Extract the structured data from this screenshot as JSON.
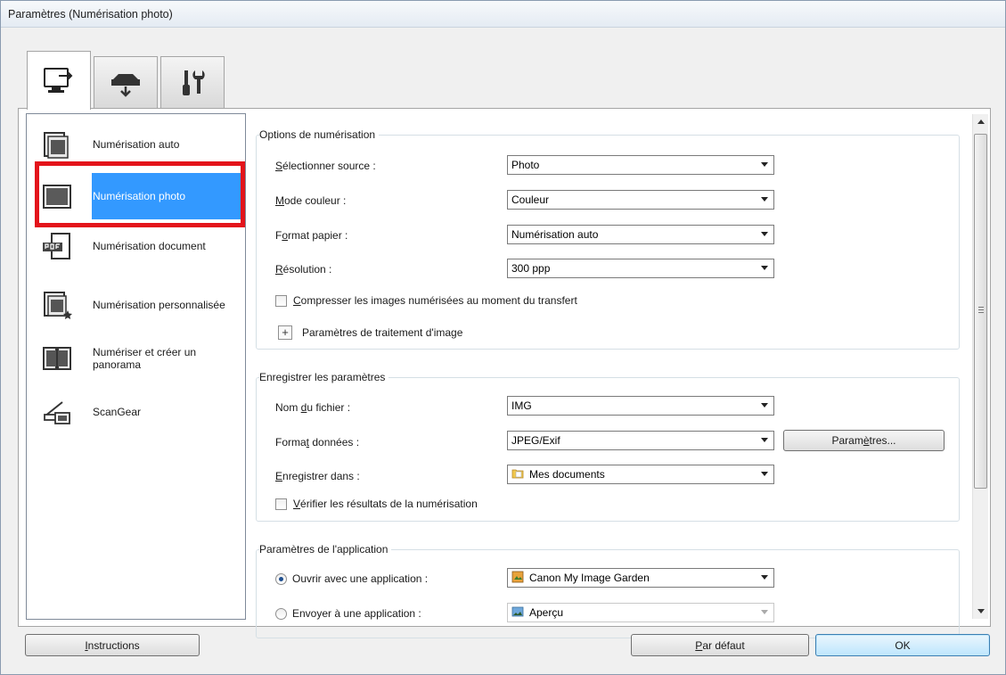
{
  "window": {
    "title": "Paramètres (Numérisation photo)"
  },
  "tabs": [
    {
      "name": "scan-from-computer",
      "icon": "computer-scan-icon",
      "active": true
    },
    {
      "name": "scan-from-operation-panel",
      "icon": "scanner-icon",
      "active": false
    },
    {
      "name": "general-settings",
      "icon": "tools-icon",
      "active": false
    }
  ],
  "sidebar": {
    "items": [
      {
        "label": "Numérisation auto",
        "icon": "auto-scan-icon"
      },
      {
        "label": "Numérisation photo",
        "icon": "photo-scan-icon",
        "selected": true
      },
      {
        "label": "Numérisation document",
        "icon": "pdf-document-scan-icon"
      },
      {
        "label": "Numérisation personnalisée",
        "icon": "custom-scan-icon"
      },
      {
        "label": "Numériser et créer un panorama",
        "icon": "stitch-scan-icon"
      },
      {
        "label": "ScanGear",
        "icon": "scangear-icon"
      }
    ]
  },
  "scan_options": {
    "title": "Options de numérisation",
    "source": {
      "label_pre": "",
      "label_u": "S",
      "label_post": "électionner source :",
      "value": "Photo"
    },
    "color_mode": {
      "label_pre": "",
      "label_u": "M",
      "label_post": "ode couleur :",
      "value": "Couleur"
    },
    "paper_size": {
      "label_pre": "F",
      "label_u": "o",
      "label_post": "rmat papier :",
      "value": "Numérisation auto"
    },
    "resolution": {
      "label_pre": "",
      "label_u": "R",
      "label_post": "ésolution :",
      "value": "300 ppp"
    },
    "compress": {
      "label_pre": "",
      "label_u": "C",
      "label_post": "ompresser les images numérisées au moment du transfert",
      "checked": false
    },
    "image_processing": {
      "label": "Paramètres de traitement d'image",
      "expand_symbol": "+"
    }
  },
  "save_settings": {
    "title": "Enregistrer les paramètres",
    "file_name": {
      "label_pre": "Nom ",
      "label_u": "d",
      "label_post": "u fichier :",
      "value": "IMG"
    },
    "data_format": {
      "label_pre": "Forma",
      "label_u": "t",
      "label_post": " données :",
      "value": "JPEG/Exif"
    },
    "settings_button": {
      "label_pre": "Param",
      "label_u": "è",
      "label_post": "tres..."
    },
    "save_in": {
      "label_pre": "",
      "label_u": "E",
      "label_post": "nregistrer dans :",
      "value": "Mes documents",
      "icon": "folder-icon"
    },
    "check_results": {
      "label_pre": "",
      "label_u": "V",
      "label_post": "érifier les résultats de la numérisation",
      "checked": false
    }
  },
  "app_settings": {
    "title": "Paramètres de l'application",
    "open_with": {
      "label": "Ouvrir avec une application :",
      "value": "Canon My Image Garden",
      "selected": true,
      "icon": "image-garden-icon"
    },
    "send_to": {
      "label": "Envoyer à une application :",
      "value": "Aperçu",
      "selected": false,
      "icon": "preview-app-icon"
    }
  },
  "footer": {
    "instructions": {
      "label_pre": "",
      "label_u": "I",
      "label_post": "nstructions"
    },
    "defaults": {
      "label_pre": "",
      "label_u": "P",
      "label_post": "ar défaut"
    },
    "ok": "OK"
  },
  "colors": {
    "selection": "#3399ff",
    "highlight_box": "#e3141b",
    "default_button": "#bee6fd"
  }
}
